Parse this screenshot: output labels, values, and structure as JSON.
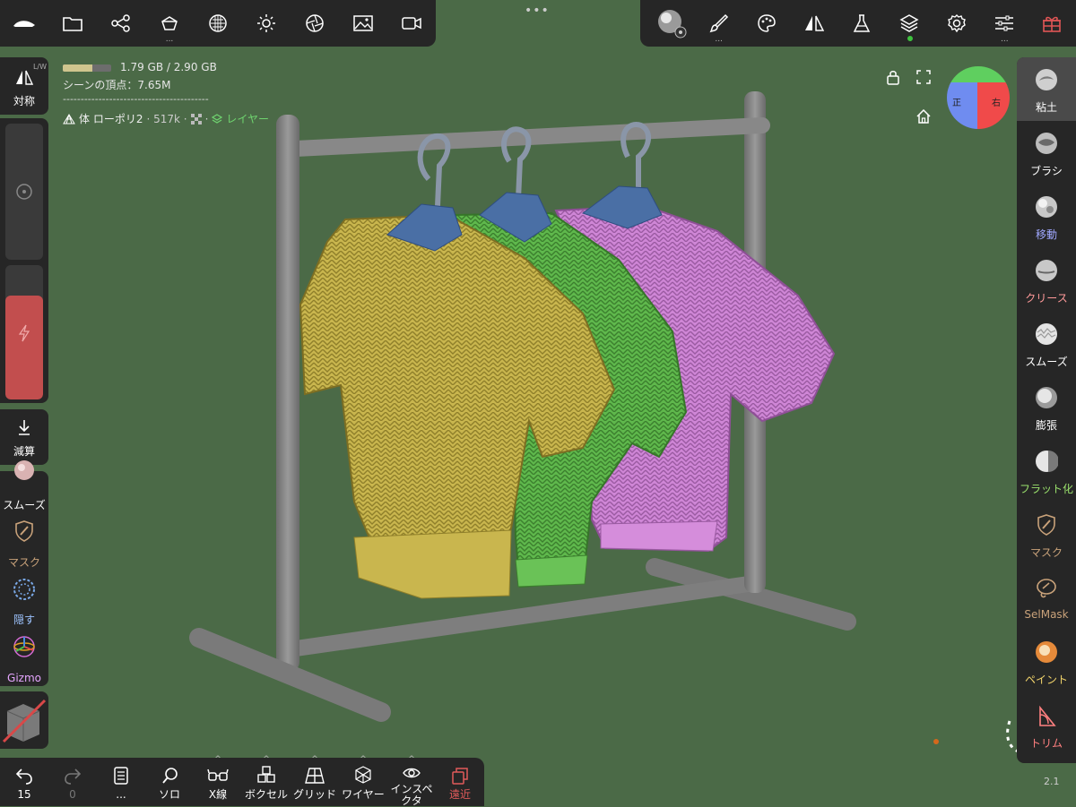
{
  "top_left": {
    "items": [
      {
        "icon": "app-logo-icon"
      },
      {
        "icon": "folder-icon"
      },
      {
        "icon": "scene-graph-icon"
      },
      {
        "icon": "scene-icon",
        "more": "..."
      },
      {
        "icon": "material-icon"
      },
      {
        "icon": "light-icon"
      },
      {
        "icon": "render-icon"
      },
      {
        "icon": "image-icon"
      },
      {
        "icon": "video-icon"
      }
    ]
  },
  "handle": "•••",
  "top_right": {
    "items": [
      {
        "icon": "matcap-icon"
      },
      {
        "icon": "brush-icon",
        "more": "..."
      },
      {
        "icon": "palette-icon"
      },
      {
        "icon": "symmetry-icon"
      },
      {
        "icon": "flask-icon"
      },
      {
        "icon": "layers-icon"
      },
      {
        "icon": "settings-icon"
      },
      {
        "icon": "sliders-icon",
        "more": "..."
      },
      {
        "icon": "gift-icon"
      }
    ]
  },
  "memory": {
    "text": "1.79 GB / 2.90 GB",
    "used_fraction": 0.617
  },
  "vertices": "シーンの頂点：7.65M",
  "separator": "-----------------------------------------",
  "object": {
    "name": "体 ローポリ2",
    "count": "· 517k ·",
    "layer": "レイヤー"
  },
  "left": {
    "symmetry_label": "対称",
    "symmetry_tag": "L/W",
    "subtract_label": "減算",
    "tools": [
      {
        "label": "スムーズ",
        "color": "#ffffff"
      },
      {
        "label": "マスク",
        "color": "#c9a27a"
      },
      {
        "label": "隠す",
        "color": "#9ec4ff"
      },
      {
        "label": "Gizmo",
        "color": "#e6a6ff"
      }
    ]
  },
  "viewport": {
    "front_label": "正",
    "right_label": "右"
  },
  "right_tools": [
    {
      "label": "粘土",
      "color": "#ffffff",
      "active": true
    },
    {
      "label": "ブラシ",
      "color": "#ffffff",
      "active": false
    },
    {
      "label": "移動",
      "color": "#a0a8ff",
      "active": false
    },
    {
      "label": "クリース",
      "color": "#ff9a9a",
      "active": false
    },
    {
      "label": "スムーズ",
      "color": "#ffffff",
      "active": false
    },
    {
      "label": "膨張",
      "color": "#ffffff",
      "active": false
    },
    {
      "label": "フラット化",
      "color": "#9be26d",
      "active": false
    },
    {
      "label": "マスク",
      "color": "#c9a27a",
      "active": false
    },
    {
      "label": "SelMask",
      "color": "#c9a27a",
      "active": false
    },
    {
      "label": "ペイント",
      "color": "#f2d46b",
      "active": false
    },
    {
      "label": "トリム",
      "color": "#ff8080",
      "active": false
    }
  ],
  "bottom": {
    "items": [
      {
        "icon": "undo-icon",
        "label": "15",
        "color": "#ffffff"
      },
      {
        "icon": "redo-icon",
        "label": "0",
        "color": "#777777"
      },
      {
        "icon": "history-icon",
        "label": "...",
        "color": "#ffffff"
      },
      {
        "icon": "solo-icon",
        "label": "ソロ",
        "color": "#ffffff"
      },
      {
        "icon": "xray-icon",
        "label": "X線",
        "color": "#ffffff"
      },
      {
        "icon": "voxel-icon",
        "label": "ボクセル",
        "color": "#ffffff"
      },
      {
        "icon": "grid-icon",
        "label": "グリッド",
        "color": "#ffffff"
      },
      {
        "icon": "wireframe-icon",
        "label": "ワイヤー",
        "color": "#ffffff"
      },
      {
        "icon": "inspector-icon",
        "label": "インスペクタ",
        "color": "#ffffff"
      },
      {
        "icon": "recent-icon",
        "label": "遠近",
        "color": "#e05a5a"
      }
    ]
  },
  "version": "2.1"
}
